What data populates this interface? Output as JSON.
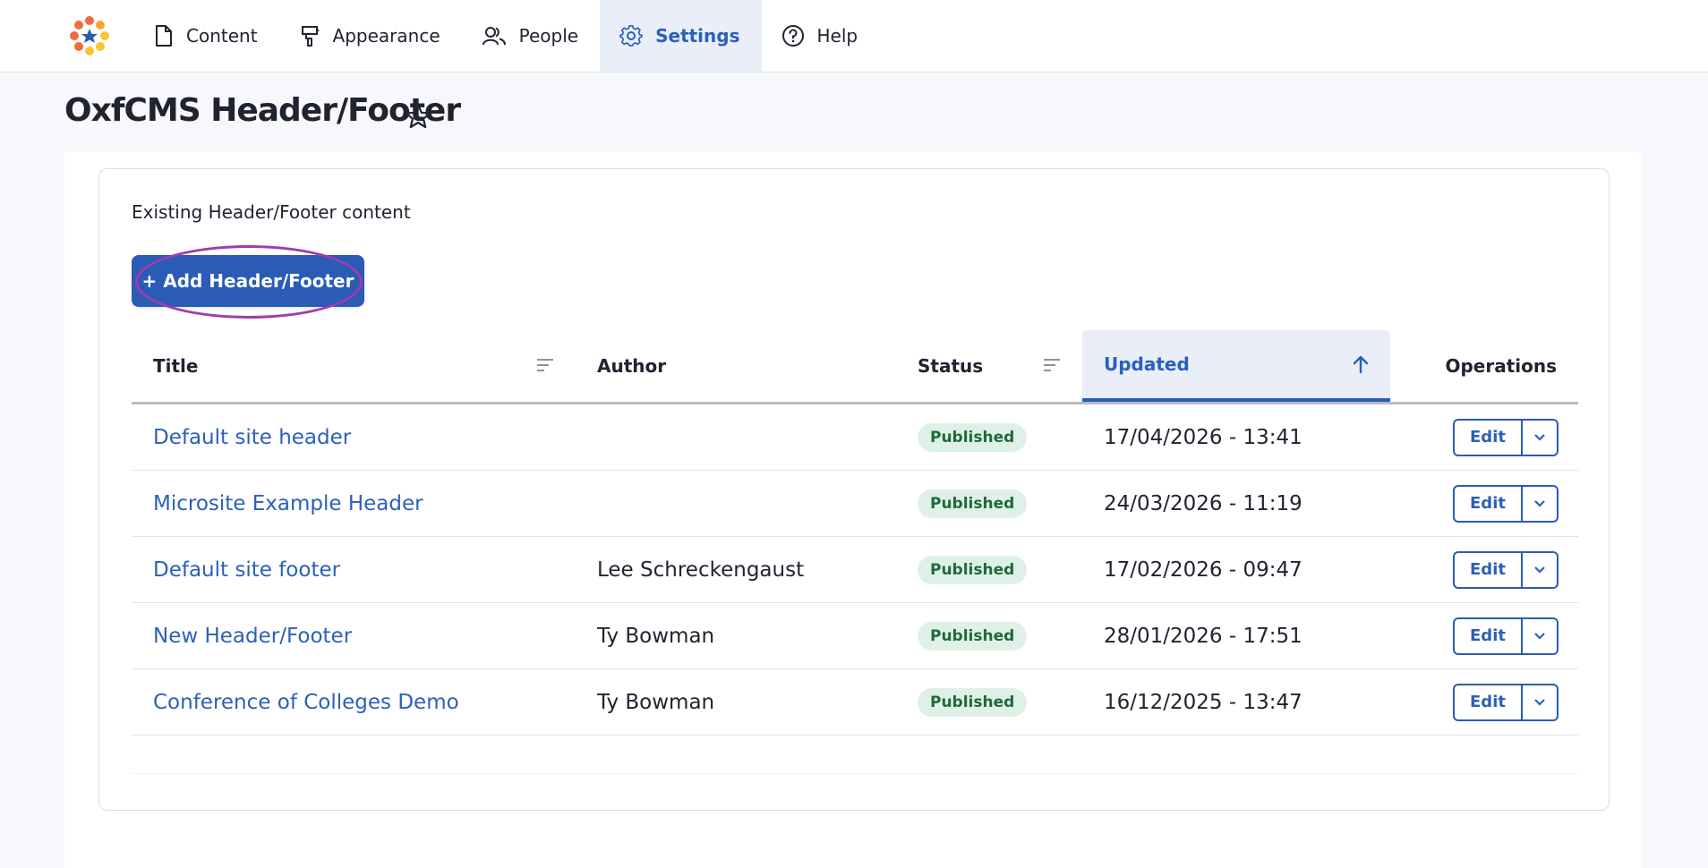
{
  "nav": {
    "items": [
      {
        "label": "Content",
        "icon": "document-icon"
      },
      {
        "label": "Appearance",
        "icon": "brush-icon"
      },
      {
        "label": "People",
        "icon": "people-icon"
      },
      {
        "label": "Settings",
        "icon": "gear-icon",
        "active": true
      },
      {
        "label": "Help",
        "icon": "help-icon"
      }
    ]
  },
  "page": {
    "title": "OxfCMS Header/Footer"
  },
  "section": {
    "label": "Existing Header/Footer content",
    "add_button": "+ Add Header/Footer"
  },
  "table": {
    "columns": {
      "title": "Title",
      "author": "Author",
      "status": "Status",
      "updated": "Updated",
      "operations": "Operations"
    },
    "rows": [
      {
        "title": "Default site header",
        "author": "",
        "status": "Published",
        "updated": "17/04/2026 - 13:41",
        "edit": "Edit"
      },
      {
        "title": "Microsite Example Header",
        "author": "",
        "status": "Published",
        "updated": "24/03/2026 - 11:19",
        "edit": "Edit"
      },
      {
        "title": "Default site footer",
        "author": "Lee Schreckengaust",
        "status": "Published",
        "updated": "17/02/2026 - 09:47",
        "edit": "Edit"
      },
      {
        "title": "New Header/Footer",
        "author": "Ty Bowman",
        "status": "Published",
        "updated": "28/01/2026 - 17:51",
        "edit": "Edit"
      },
      {
        "title": "Conference of Colleges Demo",
        "author": "Ty Bowman",
        "status": "Published",
        "updated": "16/12/2025 - 13:47",
        "edit": "Edit"
      }
    ]
  },
  "colors": {
    "accent": "#2a5cb6",
    "link": "#2c60b8",
    "badge_bg": "#dff1e6",
    "badge_text": "#1f6a3c",
    "highlight": "#a23bb0"
  }
}
